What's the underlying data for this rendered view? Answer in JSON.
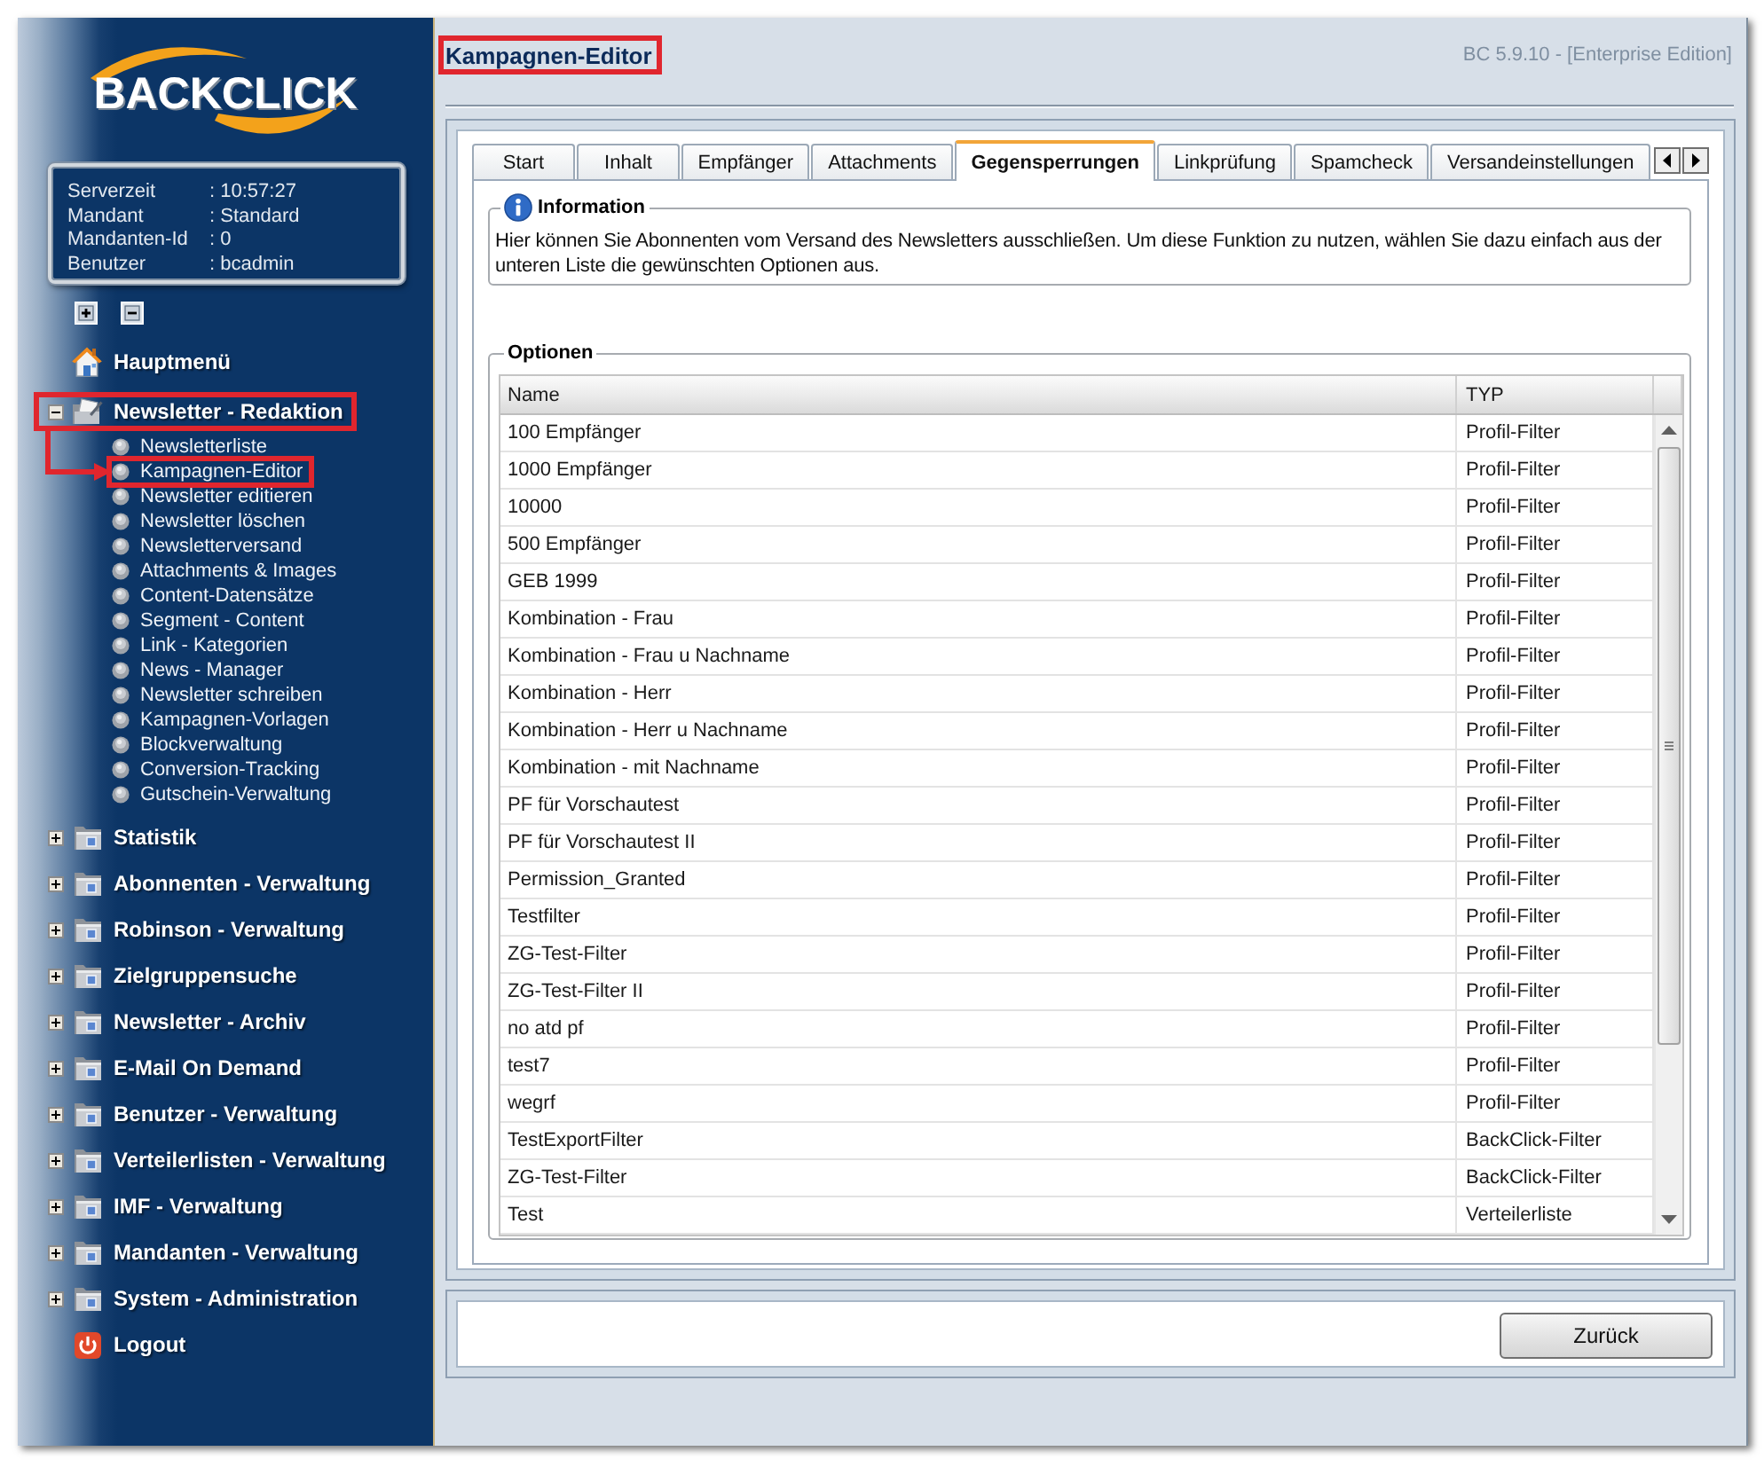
{
  "sidebar": {
    "logo": "BACKCLICK",
    "server_info": [
      {
        "label": "Serverzeit",
        "value": ": 10:57:27"
      },
      {
        "label": "Mandant",
        "value": ": Standard"
      },
      {
        "label": "Mandanten-Id",
        "value": ": 0"
      },
      {
        "label": "Benutzer",
        "value": ": bcadmin"
      }
    ],
    "menu": [
      {
        "kind": "home",
        "label": "Hauptmenü",
        "highlighted": false
      },
      {
        "kind": "editor",
        "label": "Newsletter - Redaktion",
        "expanded": true,
        "highlighted": true,
        "children": [
          {
            "label": "Newsletterliste",
            "highlighted": false
          },
          {
            "label": "Kampagnen-Editor",
            "highlighted": true
          },
          {
            "label": "Newsletter editieren",
            "highlighted": false
          },
          {
            "label": "Newsletter löschen",
            "highlighted": false
          },
          {
            "label": "Newsletterversand",
            "highlighted": false
          },
          {
            "label": "Attachments & Images",
            "highlighted": false
          },
          {
            "label": "Content-Datensätze",
            "highlighted": false
          },
          {
            "label": "Segment - Content",
            "highlighted": false
          },
          {
            "label": "Link - Kategorien",
            "highlighted": false
          },
          {
            "label": "News - Manager",
            "highlighted": false
          },
          {
            "label": "Newsletter schreiben",
            "highlighted": false
          },
          {
            "label": "Kampagnen-Vorlagen",
            "highlighted": false
          },
          {
            "label": "Blockverwaltung",
            "highlighted": false
          },
          {
            "label": "Conversion-Tracking",
            "highlighted": false
          },
          {
            "label": "Gutschein-Verwaltung",
            "highlighted": false
          }
        ]
      },
      {
        "kind": "folder",
        "label": "Statistik",
        "expanded": false,
        "highlighted": false
      },
      {
        "kind": "folder",
        "label": "Abonnenten - Verwaltung",
        "expanded": false,
        "highlighted": false
      },
      {
        "kind": "folder",
        "label": "Robinson - Verwaltung",
        "expanded": false,
        "highlighted": false
      },
      {
        "kind": "folder",
        "label": "Zielgruppensuche",
        "expanded": false,
        "highlighted": false
      },
      {
        "kind": "folder",
        "label": "Newsletter - Archiv",
        "expanded": false,
        "highlighted": false
      },
      {
        "kind": "folder",
        "label": "E-Mail On Demand",
        "expanded": false,
        "highlighted": false
      },
      {
        "kind": "folder",
        "label": "Benutzer - Verwaltung",
        "expanded": false,
        "highlighted": false
      },
      {
        "kind": "folder",
        "label": "Verteilerlisten - Verwaltung",
        "expanded": false,
        "highlighted": false
      },
      {
        "kind": "folder",
        "label": "IMF - Verwaltung",
        "expanded": false,
        "highlighted": false
      },
      {
        "kind": "folder",
        "label": "Mandanten - Verwaltung",
        "expanded": false,
        "highlighted": false
      },
      {
        "kind": "folder",
        "label": "System - Administration",
        "expanded": false,
        "highlighted": false
      },
      {
        "kind": "logout",
        "label": "Logout",
        "highlighted": false
      }
    ]
  },
  "header": {
    "title": "Kampagnen-Editor",
    "highlighted": true,
    "version": "BC 5.9.10 - [Enterprise Edition]"
  },
  "tabs": [
    {
      "label": "Start",
      "selected": false
    },
    {
      "label": "Inhalt",
      "selected": false
    },
    {
      "label": "Empfänger",
      "selected": false
    },
    {
      "label": "Attachments",
      "selected": false
    },
    {
      "label": "Gegensperrungen",
      "selected": true
    },
    {
      "label": "Linkprüfung",
      "selected": false
    },
    {
      "label": "Spamcheck",
      "selected": false
    },
    {
      "label": "Versandeinstellungen",
      "selected": false
    }
  ],
  "information": {
    "title": "Information",
    "text": "Hier können Sie Abonnenten vom Versand des Newsletters ausschließen. Um diese Funktion zu nutzen, wählen Sie dazu einfach aus der unteren Liste die gewünschten Optionen aus."
  },
  "options": {
    "title": "Optionen",
    "columns": [
      "Name",
      "TYP"
    ],
    "rows": [
      [
        "100 Empfänger",
        "Profil-Filter"
      ],
      [
        "1000 Empfänger",
        "Profil-Filter"
      ],
      [
        "10000",
        "Profil-Filter"
      ],
      [
        "500 Empfänger",
        "Profil-Filter"
      ],
      [
        "GEB 1999",
        "Profil-Filter"
      ],
      [
        "Kombination - Frau",
        "Profil-Filter"
      ],
      [
        "Kombination - Frau u Nachname",
        "Profil-Filter"
      ],
      [
        "Kombination - Herr",
        "Profil-Filter"
      ],
      [
        "Kombination - Herr u Nachname",
        "Profil-Filter"
      ],
      [
        "Kombination - mit Nachname",
        "Profil-Filter"
      ],
      [
        "PF für Vorschautest",
        "Profil-Filter"
      ],
      [
        "PF für Vorschautest II",
        "Profil-Filter"
      ],
      [
        "Permission_Granted",
        "Profil-Filter"
      ],
      [
        "Testfilter",
        "Profil-Filter"
      ],
      [
        "ZG-Test-Filter",
        "Profil-Filter"
      ],
      [
        "ZG-Test-Filter II",
        "Profil-Filter"
      ],
      [
        "no atd pf",
        "Profil-Filter"
      ],
      [
        "test7",
        "Profil-Filter"
      ],
      [
        "wegrf",
        "Profil-Filter"
      ],
      [
        "TestExportFilter",
        "BackClick-Filter"
      ],
      [
        "ZG-Test-Filter",
        "BackClick-Filter"
      ],
      [
        "Test",
        "Verteilerliste"
      ]
    ]
  },
  "footer": {
    "buttons": [
      "Zurück"
    ]
  }
}
